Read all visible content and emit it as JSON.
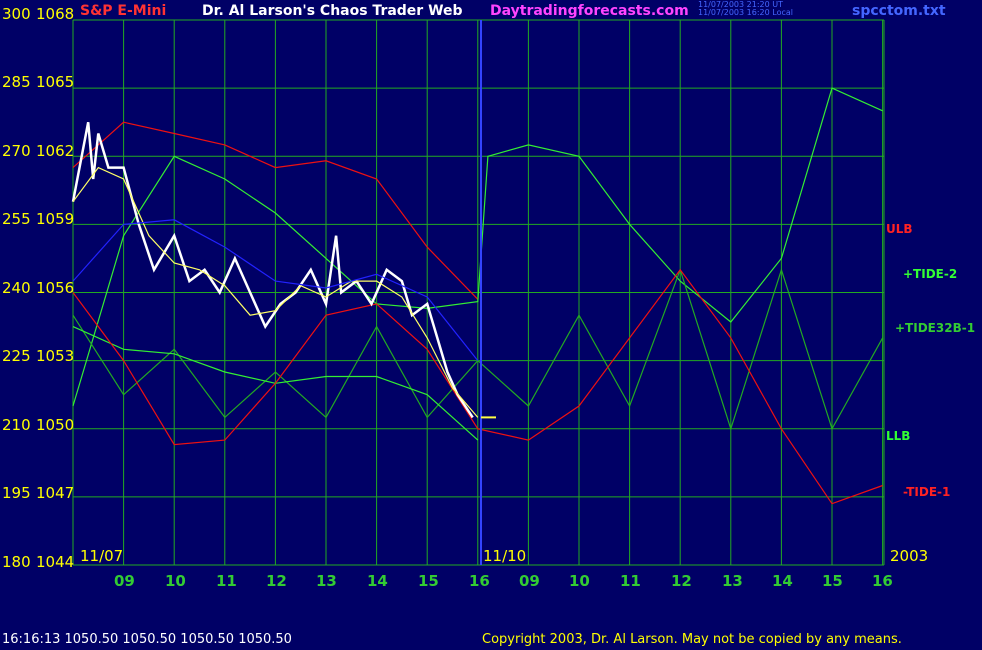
{
  "header": {
    "instrument": "S&P E-Mini",
    "title": "Dr. Al Larson's Chaos Trader Web",
    "site": "Daytradingforecasts.com",
    "stamp1": "11/07/2003 21:20 UT",
    "stamp2": "11/07/2003 16:20 Local",
    "file": "spcctom.txt"
  },
  "footer": {
    "quote": "16:16:13  1050.50 1050.50 1050.50 1050.50",
    "copyright": "Copyright 2003, Dr. Al Larson. May not be copied by any means."
  },
  "chart_data": {
    "type": "line",
    "left_axis_ticks": [
      "300",
      "285",
      "270",
      "255",
      "240",
      "225",
      "210",
      "195",
      "180"
    ],
    "price_ticks": [
      1068,
      1065,
      1062,
      1059,
      1056,
      1053,
      1050,
      1047,
      1044
    ],
    "ylim": [
      1044,
      1068
    ],
    "x_tick_labels": [
      "09",
      "10",
      "11",
      "12",
      "13",
      "14",
      "15",
      "16",
      "09",
      "10",
      "11",
      "12",
      "13",
      "14",
      "15",
      "16"
    ],
    "date_labels": [
      "11/07",
      "11/10",
      "2003"
    ],
    "legend": [
      {
        "label": "ULB",
        "color": "#ff2222"
      },
      {
        "label": "+TIDE-2",
        "color": "#33ff33"
      },
      {
        "label": "+TIDE32B-1",
        "color": "#33cc33"
      },
      {
        "label": "LLB",
        "color": "#33ff33"
      },
      {
        "label": "-TIDE-1",
        "color": "#ff2222"
      }
    ],
    "last_price": 1050.5,
    "series": [
      {
        "name": "ULB",
        "color": "#ee1111",
        "x": [
          0,
          1,
          2,
          3,
          4,
          5,
          6,
          7,
          8
        ],
        "y": [
          1061.5,
          1063.5,
          1063,
          1062.5,
          1061.5,
          1061.8,
          1061,
          1058,
          1055.7
        ]
      },
      {
        "name": "+TIDE-2",
        "color": "#33ee33",
        "x": [
          0,
          1,
          2,
          3,
          4,
          5,
          6,
          7,
          8,
          8.2,
          9,
          10,
          11,
          12,
          13,
          14,
          15,
          16
        ],
        "y": [
          1051,
          1058.5,
          1062,
          1061,
          1059.5,
          1057.5,
          1055.5,
          1055.3,
          1055.6,
          1062,
          1062.5,
          1062,
          1059,
          1056.5,
          1054.7,
          1057.5,
          1065,
          1064
        ]
      },
      {
        "name": "+TIDE32B-1",
        "color": "#22aa22",
        "x": [
          0,
          1,
          2,
          3,
          4,
          5,
          6,
          7,
          8,
          9,
          10,
          11,
          12,
          13,
          14,
          15,
          16
        ],
        "y": [
          1055,
          1051.5,
          1053.5,
          1050.5,
          1052.5,
          1050.5,
          1054.5,
          1050.5,
          1053,
          1051,
          1055,
          1051,
          1057,
          1050,
          1057,
          1050,
          1054
        ]
      },
      {
        "name": "LLB",
        "color": "#33ee33",
        "x": [
          0,
          1,
          2,
          3,
          4,
          5,
          6,
          7,
          8
        ],
        "y": [
          1054.5,
          1053.5,
          1053.3,
          1052.5,
          1052,
          1052.3,
          1052.3,
          1051.5,
          1049.5
        ]
      },
      {
        "name": "-TIDE-1",
        "color": "#ee1111",
        "x": [
          0,
          1,
          2,
          3,
          4,
          5,
          6,
          7,
          8,
          9,
          10,
          11,
          12,
          13,
          14,
          15,
          16
        ],
        "y": [
          1056,
          1053,
          1049.3,
          1049.5,
          1052,
          1055,
          1055.5,
          1053.5,
          1050,
          1049.5,
          1051,
          1054,
          1057,
          1054,
          1050,
          1046.7,
          1047.5
        ]
      },
      {
        "name": "price",
        "color": "#ffffff",
        "x": [
          0,
          0.3,
          0.4,
          0.5,
          0.7,
          1,
          1.3,
          1.6,
          2,
          2.3,
          2.6,
          2.9,
          3.2,
          3.5,
          3.8,
          4.1,
          4.4,
          4.7,
          5,
          5.2,
          5.3,
          5.6,
          5.9,
          6.2,
          6.5,
          6.7,
          7,
          7.2,
          7.4,
          7.6,
          7.9
        ],
        "y": [
          1060,
          1063.5,
          1061,
          1063,
          1061.5,
          1061.5,
          1059,
          1057,
          1058.5,
          1056.5,
          1057,
          1056,
          1057.5,
          1056,
          1054.5,
          1055.5,
          1056,
          1057,
          1055.5,
          1058.5,
          1056,
          1056.5,
          1055.5,
          1057,
          1056.5,
          1055,
          1055.5,
          1054,
          1052.5,
          1051.5,
          1050.5
        ]
      },
      {
        "name": "average",
        "color": "#ffff66",
        "x": [
          0,
          0.5,
          1,
          1.5,
          2,
          2.5,
          3,
          3.5,
          4,
          4.5,
          5,
          5.5,
          6,
          6.5,
          7,
          7.5,
          8
        ],
        "y": [
          1060,
          1061.5,
          1061,
          1058.5,
          1057.3,
          1057,
          1056.3,
          1055,
          1055.2,
          1056.3,
          1055.8,
          1056.5,
          1056.5,
          1055.8,
          1054,
          1051.8,
          1050.5
        ]
      },
      {
        "name": "trend",
        "color": "#2222ff",
        "x": [
          0,
          1,
          2,
          3,
          4,
          5,
          6,
          7,
          8
        ],
        "y": [
          1056.5,
          1059,
          1059.2,
          1058,
          1056.5,
          1056.2,
          1056.8,
          1055.8,
          1053
        ]
      }
    ]
  }
}
